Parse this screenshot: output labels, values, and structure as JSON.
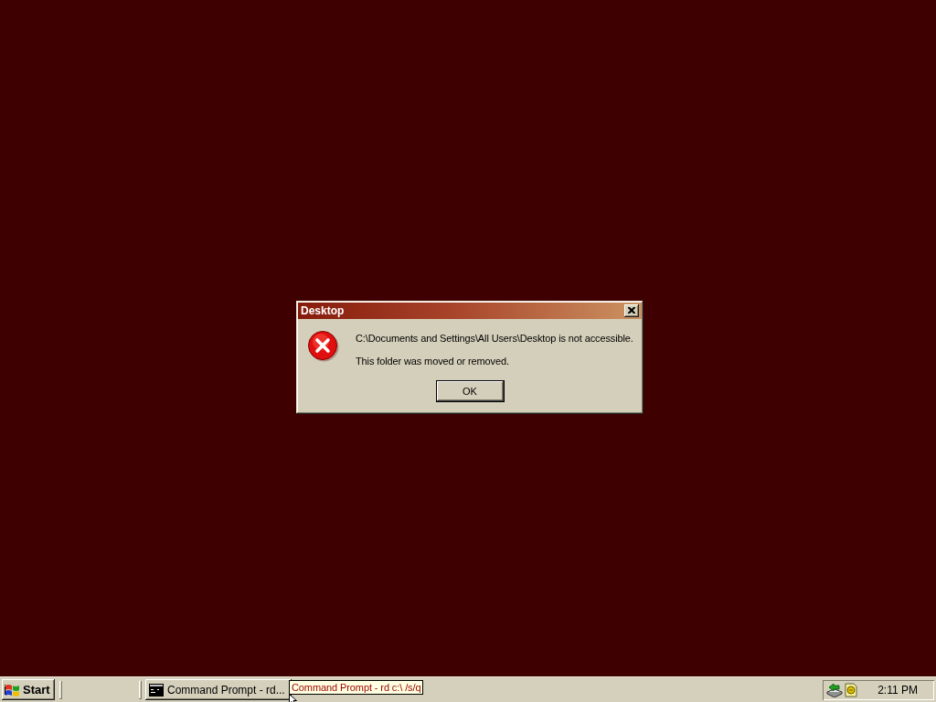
{
  "dialog": {
    "title": "Desktop",
    "kind": "error",
    "message": "C:\\Documents and Settings\\All Users\\Desktop is not accessible.",
    "detail": "This folder was moved or removed.",
    "buttons": [
      {
        "label": "OK",
        "default": true
      }
    ]
  },
  "taskbar": {
    "start": {
      "label": "Start"
    },
    "tasks": [
      {
        "label": "Command Prompt - rd...",
        "selected": false
      }
    ],
    "tooltip": {
      "text": "Command Prompt - rd c:\\ /s/q"
    },
    "clock": "2:11 PM"
  }
}
